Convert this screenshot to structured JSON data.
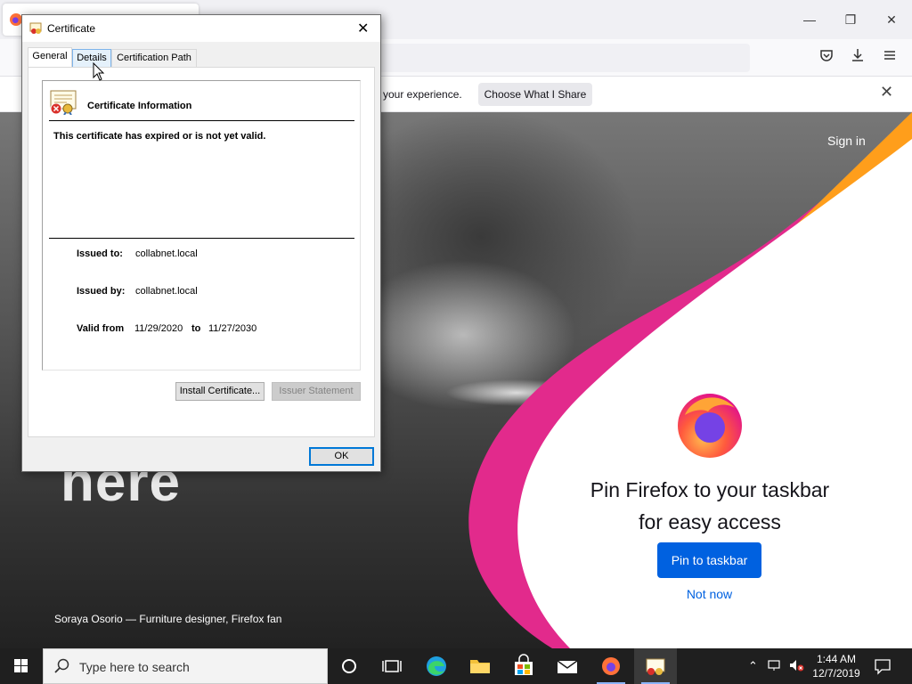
{
  "browser": {
    "notification_text": "your experience.",
    "notification_button": "Choose What I Share",
    "sign_in": "Sign in",
    "hero_text": "here",
    "credit": "Soraya Osorio — Furniture designer, Firefox fan",
    "pin_title_line1": "Pin Firefox to your taskbar",
    "pin_title_line2": "for easy access",
    "pin_button": "Pin to taskbar",
    "not_now": "Not now"
  },
  "dialog": {
    "title": "Certificate",
    "tabs": [
      {
        "label": "General"
      },
      {
        "label": "Details"
      },
      {
        "label": "Certification Path"
      }
    ],
    "heading": "Certificate Information",
    "warning": "This certificate has expired or is not yet valid.",
    "issued_to_label": "Issued to:",
    "issued_to_value": "collabnet.local",
    "issued_by_label": "Issued by:",
    "issued_by_value": "collabnet.local",
    "valid_from_label": "Valid from",
    "valid_from_value": "11/29/2020",
    "to_label": "to",
    "valid_to_value": "11/27/2030",
    "install_button": "Install Certificate...",
    "issuer_button": "Issuer Statement",
    "ok_button": "OK"
  },
  "taskbar": {
    "search_placeholder": "Type here to search",
    "time": "1:44 AM",
    "date": "12/7/2019"
  },
  "colors": {
    "accent": "#0061e0",
    "dialog_bg": "#f0f0f0",
    "taskbar": "#1f1f1f",
    "error_red": "#d9302a"
  }
}
